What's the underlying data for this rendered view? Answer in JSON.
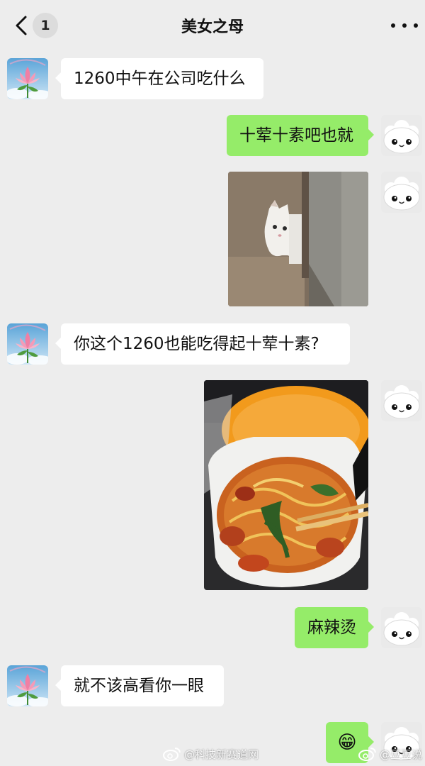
{
  "header": {
    "title": "美女之母",
    "back_badge": "1"
  },
  "messages": [
    {
      "from": "contact",
      "type": "text",
      "text": "1260中午在公司吃什么"
    },
    {
      "from": "me",
      "type": "text",
      "text": "十荤十素吧也就"
    },
    {
      "from": "me",
      "type": "image",
      "image": "cat-peeking-photo"
    },
    {
      "from": "contact",
      "type": "text",
      "text": "你这个1260也能吃得起十荤十素?"
    },
    {
      "from": "me",
      "type": "image",
      "image": "spicy-hotpot-noodles-photo"
    },
    {
      "from": "me",
      "type": "text",
      "text": "麻辣烫"
    },
    {
      "from": "contact",
      "type": "text",
      "text": "就不该高看你一眼"
    },
    {
      "from": "me",
      "type": "emoji",
      "text": "😁"
    }
  ],
  "watermarks": {
    "left": "@科技新赛道网",
    "right": "@豆豆说"
  },
  "colors": {
    "background": "#ededed",
    "incoming_bubble": "#ffffff",
    "outgoing_bubble": "#95ec69"
  }
}
